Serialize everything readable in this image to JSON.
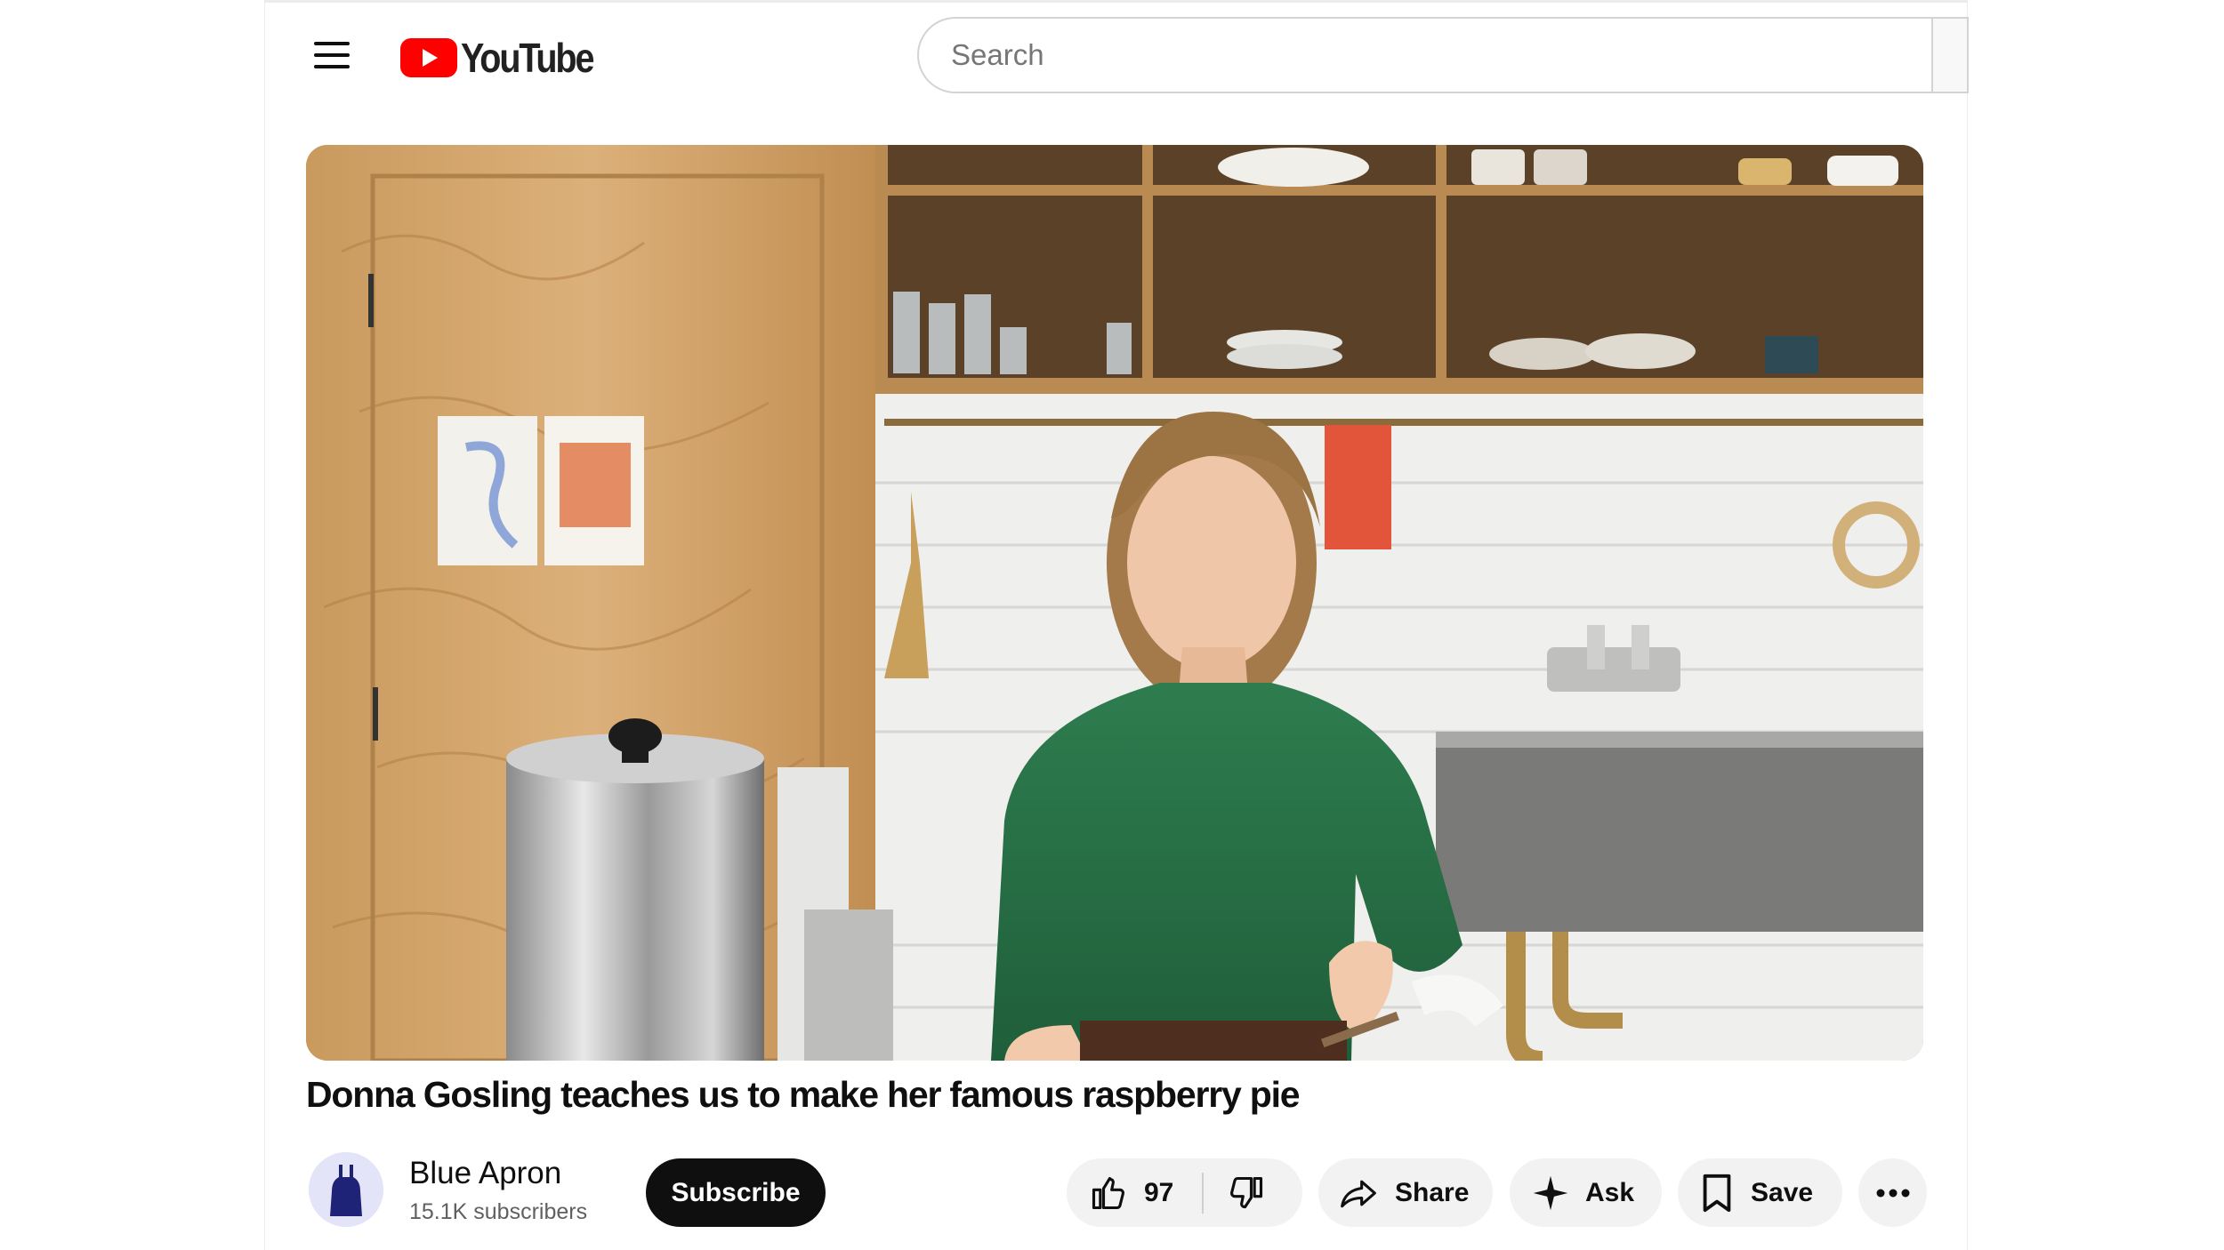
{
  "header": {
    "logo_text": "YouTube",
    "search_placeholder": "Search"
  },
  "video": {
    "title": "Donna Gosling teaches us to make her famous raspberry pie"
  },
  "channel": {
    "name": "Blue Apron",
    "subscribers": "15.1K subscribers",
    "subscribe_label": "Subscribe"
  },
  "actions": {
    "like_count": "97",
    "share_label": "Share",
    "ask_label": "Ask",
    "save_label": "Save"
  },
  "colors": {
    "brand_red": "#ff0000",
    "subscribe_bg": "#0f0f0f",
    "pill_bg": "#f2f2f2"
  },
  "icons": [
    "menu-icon",
    "youtube-logo-icon",
    "like-icon",
    "dislike-icon",
    "share-icon",
    "ask-sparkle-icon",
    "save-icon",
    "more-icon"
  ]
}
